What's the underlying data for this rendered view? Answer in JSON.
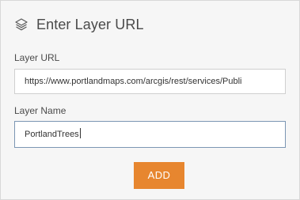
{
  "header": {
    "icon": "layers-icon",
    "title": "Enter Layer URL"
  },
  "form": {
    "url_label": "Layer URL",
    "url_value": "https://www.portlandmaps.com/arcgis/rest/services/Publi",
    "name_label": "Layer Name",
    "name_value": "PortlandTrees"
  },
  "actions": {
    "add_label": "ADD"
  },
  "colors": {
    "accent": "#e7862f",
    "panel_bg": "#f6f6f6",
    "focus_border": "#7b96b3"
  }
}
